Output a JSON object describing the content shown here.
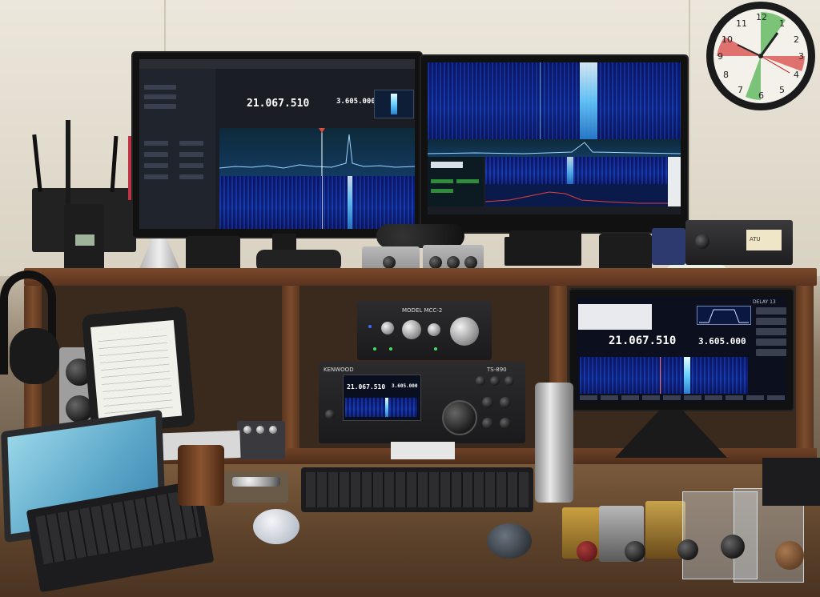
{
  "scene": {
    "left_monitor": {
      "vfo_a": "21.067.510",
      "vfo_b": "3.605.000"
    },
    "tv_monitor": {
      "delay": "DELAY 13",
      "vfo": "21.067.510",
      "vfo_sub": "3.605.000"
    },
    "controller_box": {
      "label": "MODEL MCC-2"
    },
    "radio": {
      "brand": "KENWOOD",
      "model": "TS-890",
      "display_freq": "21.067.510",
      "display_freq_sub": "3.605.000"
    },
    "clock": {
      "numbers": [
        "12",
        "1",
        "2",
        "3",
        "4",
        "5",
        "6",
        "7",
        "8",
        "9",
        "10",
        "11"
      ]
    },
    "tuner": {
      "label": "ATU"
    },
    "tin_can": {
      "color": "#b8b8b8"
    },
    "colors": {
      "waterfall_blue": "#1030a0",
      "signal_cyan": "#6ad0ff",
      "wood": "#6e4226",
      "clock_red_sector": "#d9534f",
      "clock_green_sector": "#4caf50"
    }
  }
}
